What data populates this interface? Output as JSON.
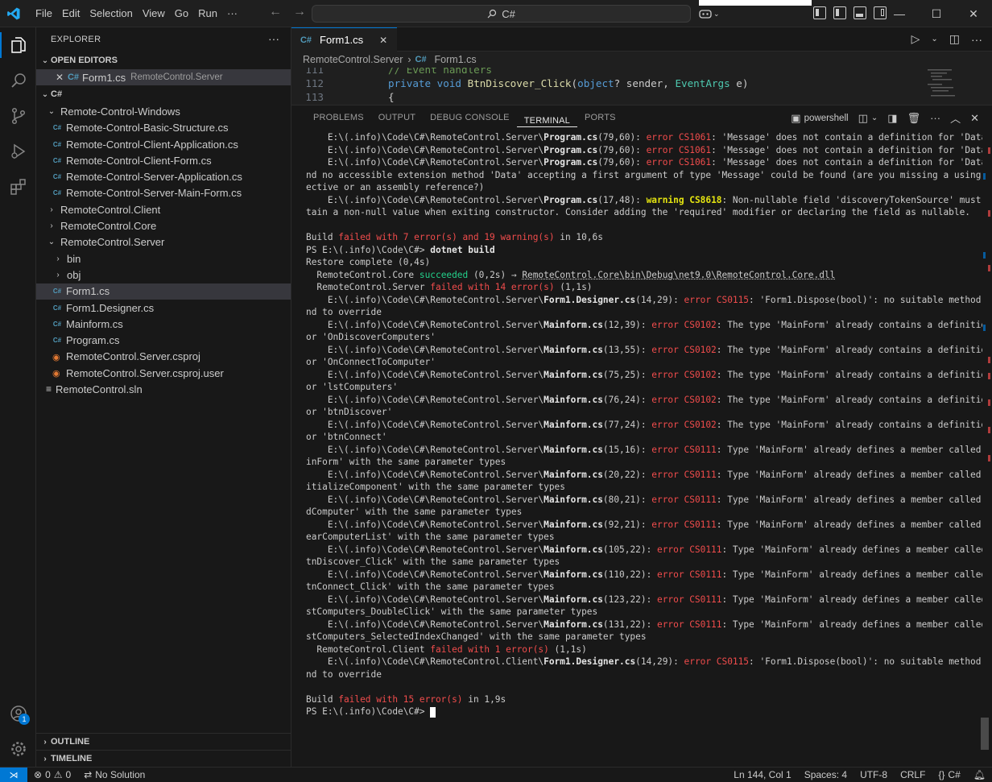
{
  "menu": [
    "File",
    "Edit",
    "Selection",
    "View",
    "Go",
    "Run",
    "···"
  ],
  "command_center": "C#",
  "window_controls": {
    "minimize": "—",
    "maximize": "☐",
    "close": "✕"
  },
  "explorer": {
    "title": "EXPLORER",
    "more": "···",
    "open_editors_header": "OPEN EDITORS",
    "open_editor": {
      "name": "Form1.cs",
      "desc": "RemoteControl.Server"
    },
    "workspace_header": "C#",
    "tree": [
      {
        "label": "Remote-Control-Windows",
        "type": "folder-open",
        "indent": 1
      },
      {
        "label": "Remote-Control-Basic-Structure.cs",
        "type": "cs",
        "indent": 2
      },
      {
        "label": "Remote-Control-Client-Application.cs",
        "type": "cs",
        "indent": 2
      },
      {
        "label": "Remote-Control-Client-Form.cs",
        "type": "cs",
        "indent": 2
      },
      {
        "label": "Remote-Control-Server-Application.cs",
        "type": "cs",
        "indent": 2
      },
      {
        "label": "Remote-Control-Server-Main-Form.cs",
        "type": "cs",
        "indent": 2
      },
      {
        "label": "RemoteControl.Client",
        "type": "folder",
        "indent": 1
      },
      {
        "label": "RemoteControl.Core",
        "type": "folder",
        "indent": 1
      },
      {
        "label": "RemoteControl.Server",
        "type": "folder-open",
        "indent": 1
      },
      {
        "label": "bin",
        "type": "folder",
        "indent": 2
      },
      {
        "label": "obj",
        "type": "folder",
        "indent": 2
      },
      {
        "label": "Form1.cs",
        "type": "cs",
        "indent": 2,
        "selected": true
      },
      {
        "label": "Form1.Designer.cs",
        "type": "cs",
        "indent": 2
      },
      {
        "label": "Mainform.cs",
        "type": "cs",
        "indent": 2
      },
      {
        "label": "Program.cs",
        "type": "cs",
        "indent": 2
      },
      {
        "label": "RemoteControl.Server.csproj",
        "type": "rss",
        "indent": 2
      },
      {
        "label": "RemoteControl.Server.csproj.user",
        "type": "rss",
        "indent": 2
      },
      {
        "label": "RemoteControl.sln",
        "type": "sln",
        "indent": 1
      }
    ],
    "outline": "OUTLINE",
    "timeline": "TIMELINE"
  },
  "editor": {
    "tab": "Form1.cs",
    "breadcrumb": [
      "RemoteControl.Server",
      "Form1.cs"
    ],
    "lines": [
      {
        "num": "111",
        "code": "// Event handlers"
      },
      {
        "num": "112",
        "code": "private void BtnDiscover_Click(object? sender, EventArgs e)"
      },
      {
        "num": "113",
        "code": "{"
      }
    ]
  },
  "panel": {
    "tabs": [
      "PROBLEMS",
      "OUTPUT",
      "DEBUG CONSOLE",
      "TERMINAL",
      "PORTS"
    ],
    "active_tab": "TERMINAL",
    "shell": "powershell"
  },
  "terminal_lines": [
    [
      [
        "    E:\\(.info)\\Code\\C#\\RemoteControl.Server\\",
        ""
      ],
      [
        "Program.cs",
        "bold"
      ],
      [
        "(79,60): ",
        ""
      ],
      [
        "error CS1061",
        "err"
      ],
      [
        ": 'Message' does not contain a definition for 'Data' a",
        ""
      ]
    ],
    [
      [
        "    E:\\(.info)\\Code\\C#\\RemoteControl.Server\\",
        ""
      ],
      [
        "Program.cs",
        "bold"
      ],
      [
        "(79,60): ",
        ""
      ],
      [
        "error CS1061",
        "err"
      ],
      [
        ": 'Message' does not contain a definition for 'Data' a",
        ""
      ]
    ],
    [
      [
        "    E:\\(.info)\\Code\\C#\\RemoteControl.Server\\",
        ""
      ],
      [
        "Program.cs",
        "bold"
      ],
      [
        "(79,60): ",
        ""
      ],
      [
        "error CS1061",
        "err"
      ],
      [
        ": 'Message' does not contain a definition for 'Data' a",
        ""
      ]
    ],
    [
      [
        "nd no accessible extension method 'Data' accepting a first argument of type 'Message' could be found (are you missing a using dir",
        ""
      ]
    ],
    [
      [
        "ective or an assembly reference?)",
        ""
      ]
    ],
    [
      [
        "    E:\\(.info)\\Code\\C#\\RemoteControl.Server\\",
        ""
      ],
      [
        "Program.cs",
        "bold"
      ],
      [
        "(17,48): ",
        ""
      ],
      [
        "warning CS8618",
        "warn"
      ],
      [
        ": Non-nullable field 'discoveryTokenSource' must con",
        ""
      ]
    ],
    [
      [
        "tain a non-null value when exiting constructor. Consider adding the 'required' modifier or declaring the field as nullable.",
        ""
      ]
    ],
    [
      [
        "",
        ""
      ]
    ],
    [
      [
        "Build ",
        ""
      ],
      [
        "failed with 7 error(s) and 19 warning(s)",
        "err"
      ],
      [
        " in 10,6s",
        ""
      ]
    ],
    [
      [
        "PS E:\\(.info)\\Code\\C#> ",
        ""
      ],
      [
        "dotnet build",
        "bold"
      ]
    ],
    [
      [
        "Restore complete (0,4s)",
        ""
      ]
    ],
    [
      [
        "  RemoteControl.Core ",
        ""
      ],
      [
        "succeeded",
        "ok"
      ],
      [
        " (0,2s) → ",
        ""
      ],
      [
        "RemoteControl.Core\\bin\\Debug\\net9.0\\RemoteControl.Core.dll",
        "link"
      ]
    ],
    [
      [
        "  RemoteControl.Server ",
        ""
      ],
      [
        "failed with 14 error(s)",
        "err"
      ],
      [
        " (1,1s)",
        ""
      ]
    ],
    [
      [
        "    E:\\(.info)\\Code\\C#\\RemoteControl.Server\\",
        ""
      ],
      [
        "Form1.Designer.cs",
        "bold"
      ],
      [
        "(14,29): ",
        ""
      ],
      [
        "error CS0115",
        "err"
      ],
      [
        ": 'Form1.Dispose(bool)': no suitable method fou",
        ""
      ]
    ],
    [
      [
        "nd to override",
        ""
      ]
    ],
    [
      [
        "    E:\\(.info)\\Code\\C#\\RemoteControl.Server\\",
        ""
      ],
      [
        "Mainform.cs",
        "bold"
      ],
      [
        "(12,39): ",
        ""
      ],
      [
        "error CS0102",
        "err"
      ],
      [
        ": The type 'MainForm' already contains a definition f",
        ""
      ]
    ],
    [
      [
        "or 'OnDiscoverComputers'",
        ""
      ]
    ],
    [
      [
        "    E:\\(.info)\\Code\\C#\\RemoteControl.Server\\",
        ""
      ],
      [
        "Mainform.cs",
        "bold"
      ],
      [
        "(13,55): ",
        ""
      ],
      [
        "error CS0102",
        "err"
      ],
      [
        ": The type 'MainForm' already contains a definition f",
        ""
      ]
    ],
    [
      [
        "or 'OnConnectToComputer'",
        ""
      ]
    ],
    [
      [
        "    E:\\(.info)\\Code\\C#\\RemoteControl.Server\\",
        ""
      ],
      [
        "Mainform.cs",
        "bold"
      ],
      [
        "(75,25): ",
        ""
      ],
      [
        "error CS0102",
        "err"
      ],
      [
        ": The type 'MainForm' already contains a definition f",
        ""
      ]
    ],
    [
      [
        "or 'lstComputers'",
        ""
      ]
    ],
    [
      [
        "    E:\\(.info)\\Code\\C#\\RemoteControl.Server\\",
        ""
      ],
      [
        "Mainform.cs",
        "bold"
      ],
      [
        "(76,24): ",
        ""
      ],
      [
        "error CS0102",
        "err"
      ],
      [
        ": The type 'MainForm' already contains a definition f",
        ""
      ]
    ],
    [
      [
        "or 'btnDiscover'",
        ""
      ]
    ],
    [
      [
        "    E:\\(.info)\\Code\\C#\\RemoteControl.Server\\",
        ""
      ],
      [
        "Mainform.cs",
        "bold"
      ],
      [
        "(77,24): ",
        ""
      ],
      [
        "error CS0102",
        "err"
      ],
      [
        ": The type 'MainForm' already contains a definition f",
        ""
      ]
    ],
    [
      [
        "or 'btnConnect'",
        ""
      ]
    ],
    [
      [
        "    E:\\(.info)\\Code\\C#\\RemoteControl.Server\\",
        ""
      ],
      [
        "Mainform.cs",
        "bold"
      ],
      [
        "(15,16): ",
        ""
      ],
      [
        "error CS0111",
        "err"
      ],
      [
        ": Type 'MainForm' already defines a member called 'Ma",
        ""
      ]
    ],
    [
      [
        "inForm' with the same parameter types",
        ""
      ]
    ],
    [
      [
        "    E:\\(.info)\\Code\\C#\\RemoteControl.Server\\",
        ""
      ],
      [
        "Mainform.cs",
        "bold"
      ],
      [
        "(20,22): ",
        ""
      ],
      [
        "error CS0111",
        "err"
      ],
      [
        ": Type 'MainForm' already defines a member called 'In",
        ""
      ]
    ],
    [
      [
        "itializeComponent' with the same parameter types",
        ""
      ]
    ],
    [
      [
        "    E:\\(.info)\\Code\\C#\\RemoteControl.Server\\",
        ""
      ],
      [
        "Mainform.cs",
        "bold"
      ],
      [
        "(80,21): ",
        ""
      ],
      [
        "error CS0111",
        "err"
      ],
      [
        ": Type 'MainForm' already defines a member called 'Ad",
        ""
      ]
    ],
    [
      [
        "dComputer' with the same parameter types",
        ""
      ]
    ],
    [
      [
        "    E:\\(.info)\\Code\\C#\\RemoteControl.Server\\",
        ""
      ],
      [
        "Mainform.cs",
        "bold"
      ],
      [
        "(92,21): ",
        ""
      ],
      [
        "error CS0111",
        "err"
      ],
      [
        ": Type 'MainForm' already defines a member called 'Cl",
        ""
      ]
    ],
    [
      [
        "earComputerList' with the same parameter types",
        ""
      ]
    ],
    [
      [
        "    E:\\(.info)\\Code\\C#\\RemoteControl.Server\\",
        ""
      ],
      [
        "Mainform.cs",
        "bold"
      ],
      [
        "(105,22): ",
        ""
      ],
      [
        "error CS0111",
        "err"
      ],
      [
        ": Type 'MainForm' already defines a member called 'B",
        ""
      ]
    ],
    [
      [
        "tnDiscover_Click' with the same parameter types",
        ""
      ]
    ],
    [
      [
        "    E:\\(.info)\\Code\\C#\\RemoteControl.Server\\",
        ""
      ],
      [
        "Mainform.cs",
        "bold"
      ],
      [
        "(110,22): ",
        ""
      ],
      [
        "error CS0111",
        "err"
      ],
      [
        ": Type 'MainForm' already defines a member called 'B",
        ""
      ]
    ],
    [
      [
        "tnConnect_Click' with the same parameter types",
        ""
      ]
    ],
    [
      [
        "    E:\\(.info)\\Code\\C#\\RemoteControl.Server\\",
        ""
      ],
      [
        "Mainform.cs",
        "bold"
      ],
      [
        "(123,22): ",
        ""
      ],
      [
        "error CS0111",
        "err"
      ],
      [
        ": Type 'MainForm' already defines a member called 'L",
        ""
      ]
    ],
    [
      [
        "stComputers_DoubleClick' with the same parameter types",
        ""
      ]
    ],
    [
      [
        "    E:\\(.info)\\Code\\C#\\RemoteControl.Server\\",
        ""
      ],
      [
        "Mainform.cs",
        "bold"
      ],
      [
        "(131,22): ",
        ""
      ],
      [
        "error CS0111",
        "err"
      ],
      [
        ": Type 'MainForm' already defines a member called 'L",
        ""
      ]
    ],
    [
      [
        "stComputers_SelectedIndexChanged' with the same parameter types",
        ""
      ]
    ],
    [
      [
        "  RemoteControl.Client ",
        ""
      ],
      [
        "failed with 1 error(s)",
        "err"
      ],
      [
        " (1,1s)",
        ""
      ]
    ],
    [
      [
        "    E:\\(.info)\\Code\\C#\\RemoteControl.Client\\",
        ""
      ],
      [
        "Form1.Designer.cs",
        "bold"
      ],
      [
        "(14,29): ",
        ""
      ],
      [
        "error CS0115",
        "err"
      ],
      [
        ": 'Form1.Dispose(bool)': no suitable method fou",
        ""
      ]
    ],
    [
      [
        "nd to override",
        ""
      ]
    ],
    [
      [
        "",
        ""
      ]
    ],
    [
      [
        "Build ",
        ""
      ],
      [
        "failed with 15 error(s)",
        "err"
      ],
      [
        " in 1,9s",
        ""
      ]
    ],
    [
      [
        "PS E:\\(.info)\\Code\\C#> ",
        ""
      ]
    ]
  ],
  "statusbar": {
    "errors": "0",
    "warnings": "0",
    "solution": "No Solution",
    "position": "Ln 144, Col 1",
    "spaces": "Spaces: 4",
    "encoding": "UTF-8",
    "eol": "CRLF",
    "language": "C#"
  },
  "colors": {
    "accent": "#0078d4",
    "error": "#f14c4c",
    "warning": "#e5e510",
    "success": "#23d18b"
  }
}
